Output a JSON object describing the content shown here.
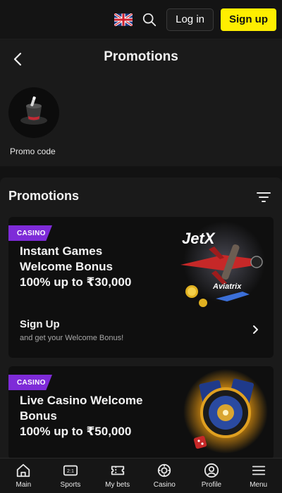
{
  "topbar": {
    "flag_icon": "uk-flag-icon",
    "search_icon": "search-icon",
    "login_label": "Log in",
    "signup_label": "Sign up",
    "accent_color": "#ffee00"
  },
  "page": {
    "title": "Promotions",
    "promo_code_label": "Promo code"
  },
  "promotions": {
    "section_title": "Promotions",
    "tag_color": "#7e2bd8",
    "cards": [
      {
        "tag": "CASINO",
        "title_lines": [
          "Instant Games",
          "Welcome Bonus",
          "100% up to ₹30,000"
        ],
        "art_text": [
          "JetX",
          "Aviatrix"
        ],
        "cta_title": "Sign Up",
        "cta_subtitle": "and get your Welcome Bonus!"
      },
      {
        "tag": "CASINO",
        "title_lines": [
          "Live Casino Welcome",
          "Bonus",
          "100% up to ₹50,000"
        ]
      }
    ]
  },
  "bottom_nav": [
    {
      "label": "Main",
      "icon": "home-icon"
    },
    {
      "label": "Sports",
      "icon": "scoreboard-icon"
    },
    {
      "label": "My bets",
      "icon": "ticket-icon"
    },
    {
      "label": "Casino",
      "icon": "chip-icon"
    },
    {
      "label": "Profile",
      "icon": "user-icon"
    },
    {
      "label": "Menu",
      "icon": "menu-icon"
    }
  ]
}
